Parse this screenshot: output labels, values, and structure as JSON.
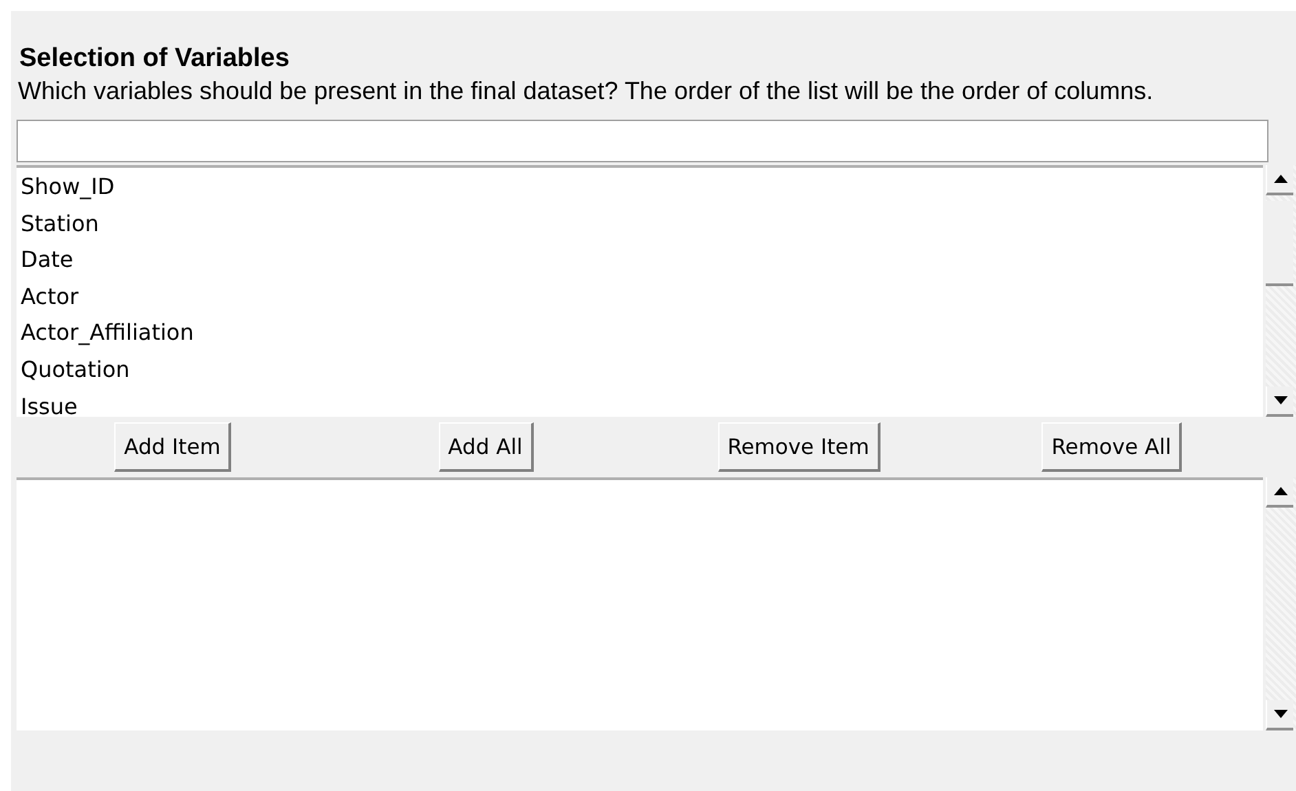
{
  "section": {
    "title": "Selection of Variables",
    "description": "Which variables should be present in the final dataset? The order of the list will be the order of columns."
  },
  "available_list": {
    "items": [
      {
        "label": "Show_ID",
        "selected": false
      },
      {
        "label": "Station",
        "selected": false
      },
      {
        "label": "Date",
        "selected": false
      },
      {
        "label": "Actor",
        "selected": false
      },
      {
        "label": "Actor_Affiliation",
        "selected": false
      },
      {
        "label": "Quotation",
        "selected": false
      },
      {
        "label": "Issue",
        "selected": false
      }
    ]
  },
  "buttons": [
    "Add Item",
    "Add All",
    "Remove Item",
    "Remove All"
  ]
}
